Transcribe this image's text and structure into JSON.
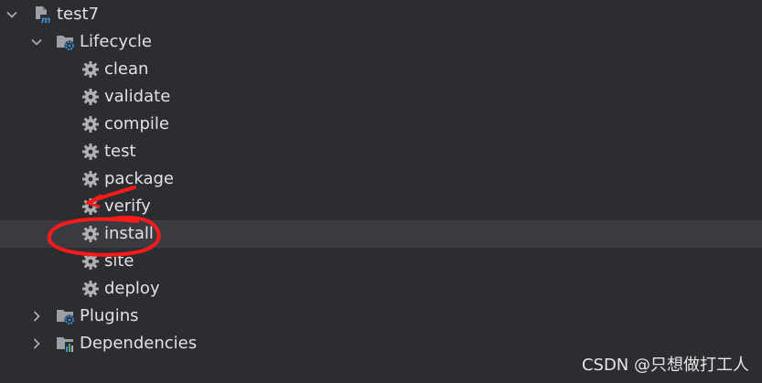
{
  "tree": {
    "root": {
      "label": "test7",
      "icon": "maven-module-icon",
      "expanded": true
    },
    "lifecycle": {
      "label": "Lifecycle",
      "icon": "lifecycle-folder-icon",
      "expanded": true
    },
    "goals": [
      {
        "label": "clean",
        "icon": "gear-icon"
      },
      {
        "label": "validate",
        "icon": "gear-icon"
      },
      {
        "label": "compile",
        "icon": "gear-icon"
      },
      {
        "label": "test",
        "icon": "gear-icon"
      },
      {
        "label": "package",
        "icon": "gear-icon"
      },
      {
        "label": "verify",
        "icon": "gear-icon"
      },
      {
        "label": "install",
        "icon": "gear-icon",
        "selected": true
      },
      {
        "label": "site",
        "icon": "gear-icon"
      },
      {
        "label": "deploy",
        "icon": "gear-icon"
      }
    ],
    "plugins": {
      "label": "Plugins",
      "icon": "plugins-folder-icon",
      "expanded": false
    },
    "dependencies": {
      "label": "Dependencies",
      "icon": "dependencies-folder-icon",
      "expanded": false
    }
  },
  "watermark": "CSDN @只想做打工人",
  "colors": {
    "background": "#2b2d30",
    "selected_row": "#393b40",
    "text": "#dfe1e5",
    "icon_gray": "#afb1b3",
    "folder_blue": "#3d8fd6",
    "annotation_red": "#ff1a1a"
  }
}
